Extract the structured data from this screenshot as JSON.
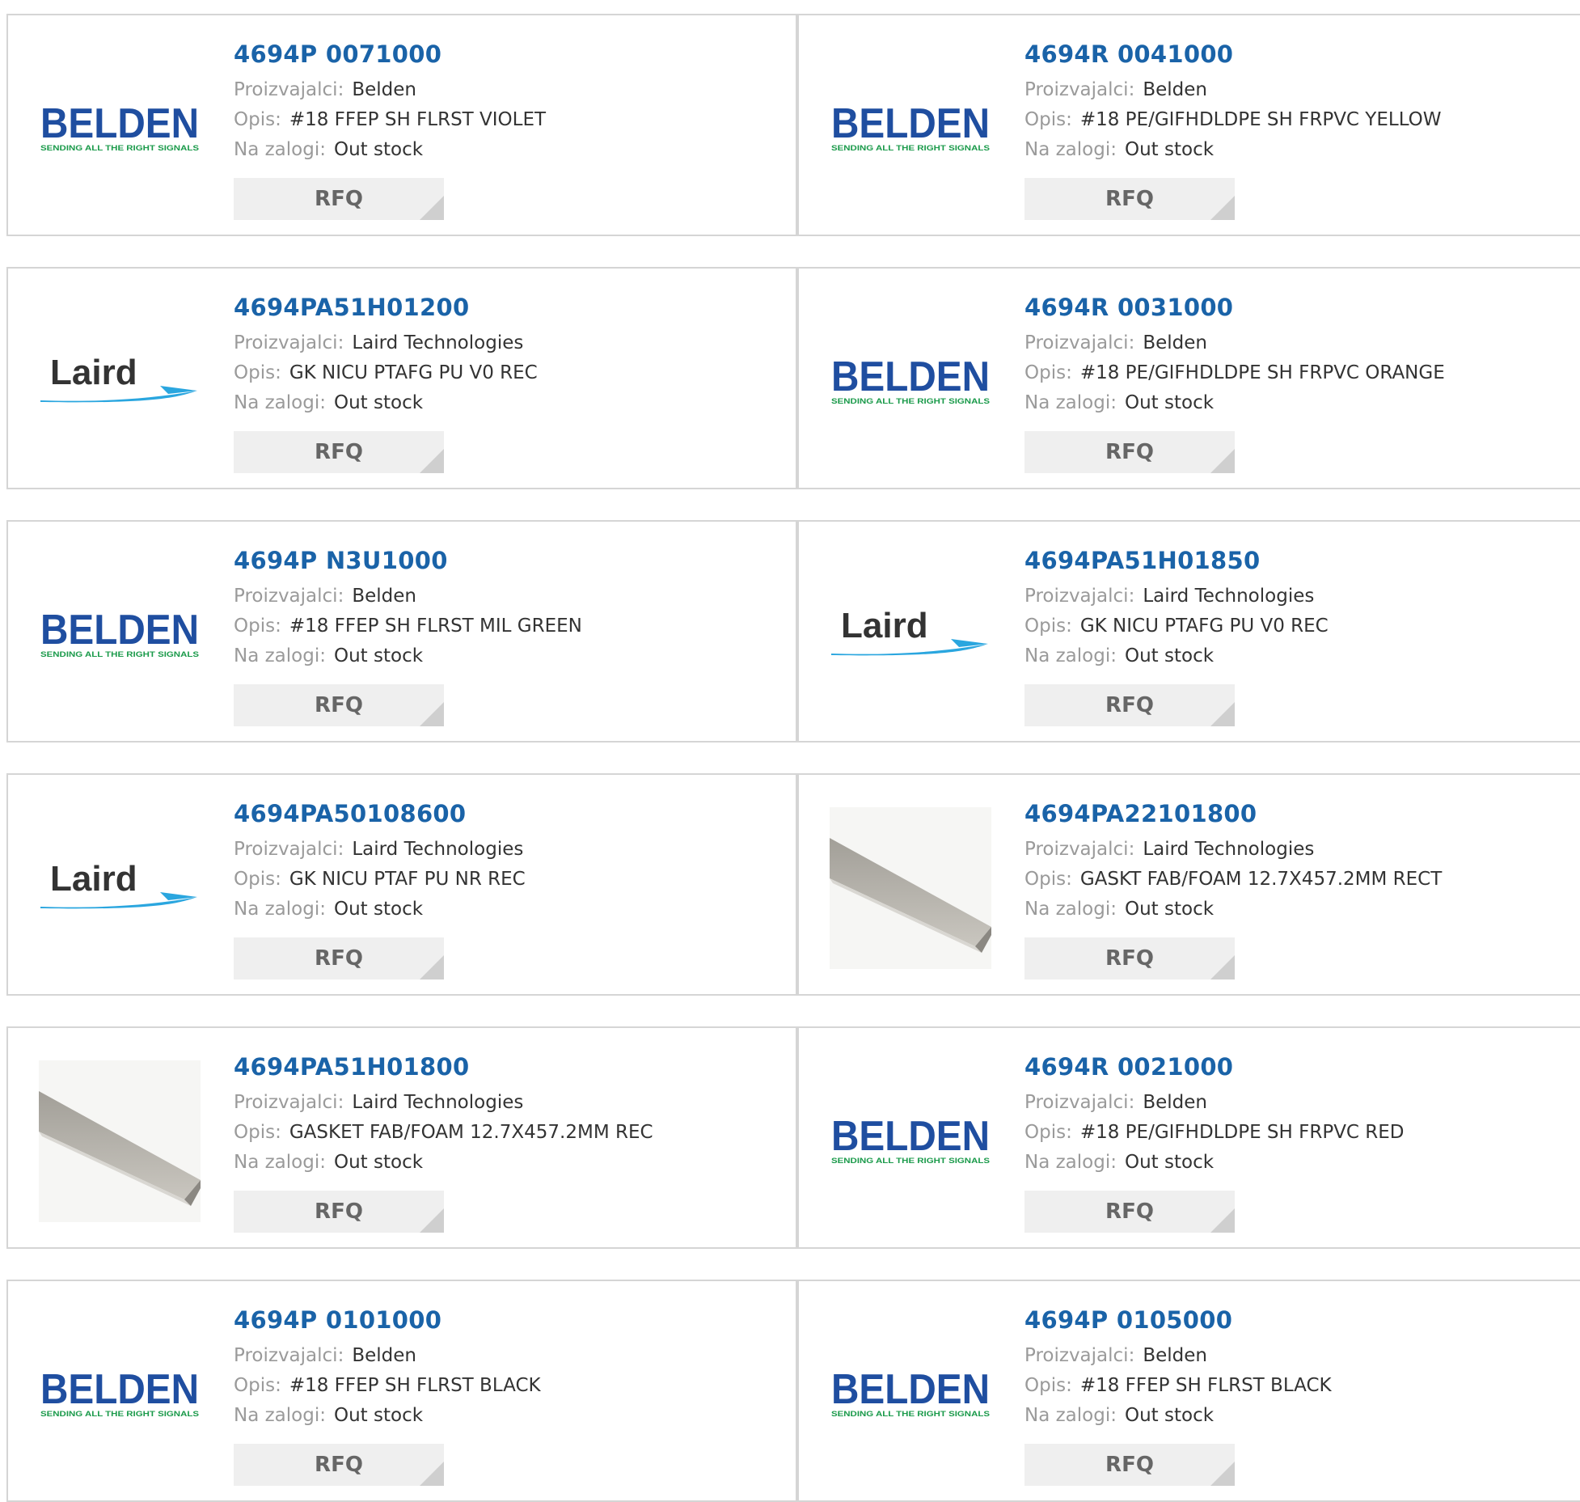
{
  "labels": {
    "manufacturer": "Proizvajalci:",
    "description": "Opis:",
    "stock": "Na zalogi:",
    "rfq": "RFQ"
  },
  "logos": {
    "belden_wordmark": "BELDEN",
    "belden_tagline": "SENDING ALL THE RIGHT SIGNALS",
    "laird_wordmark": "Laird"
  },
  "colors": {
    "part_number": "#1a63a8",
    "belden_blue": "#1f4ea0",
    "belden_green": "#1a9a4a",
    "laird_swoosh": "#2aa6df",
    "rfq_bg": "#efefef"
  },
  "products": [
    {
      "part": "4694P 0071000",
      "manufacturer": "Belden",
      "description": "#18 FFEP SH FLRST VIOLET",
      "stock": "Out stock",
      "image": "belden-logo"
    },
    {
      "part": "4694R 0041000",
      "manufacturer": "Belden",
      "description": "#18 PE/GIFHDLDPE SH FRPVC YELLOW",
      "stock": "Out stock",
      "image": "belden-logo"
    },
    {
      "part": "4694PA51H01200",
      "manufacturer": "Laird Technologies",
      "description": "GK NICU PTAFG PU V0 REC",
      "stock": "Out stock",
      "image": "laird-logo"
    },
    {
      "part": "4694R 0031000",
      "manufacturer": "Belden",
      "description": "#18 PE/GIFHDLDPE SH FRPVC ORANGE",
      "stock": "Out stock",
      "image": "belden-logo"
    },
    {
      "part": "4694P N3U1000",
      "manufacturer": "Belden",
      "description": "#18 FFEP SH FLRST MIL GREEN",
      "stock": "Out stock",
      "image": "belden-logo"
    },
    {
      "part": "4694PA51H01850",
      "manufacturer": "Laird Technologies",
      "description": "GK NICU PTAFG PU V0 REC",
      "stock": "Out stock",
      "image": "laird-logo"
    },
    {
      "part": "4694PA50108600",
      "manufacturer": "Laird Technologies",
      "description": "GK NICU PTAF PU NR REC",
      "stock": "Out stock",
      "image": "laird-logo"
    },
    {
      "part": "4694PA22101800",
      "manufacturer": "Laird Technologies",
      "description": "GASKT FAB/FOAM 12.7X457.2MM RECT",
      "stock": "Out stock",
      "image": "gasket-photo"
    },
    {
      "part": "4694PA51H01800",
      "manufacturer": "Laird Technologies",
      "description": "GASKET FAB/FOAM 12.7X457.2MM REC",
      "stock": "Out stock",
      "image": "gasket-photo"
    },
    {
      "part": "4694R 0021000",
      "manufacturer": "Belden",
      "description": "#18 PE/GIFHDLDPE SH FRPVC RED",
      "stock": "Out stock",
      "image": "belden-logo"
    },
    {
      "part": "4694P 0101000",
      "manufacturer": "Belden",
      "description": "#18 FFEP SH FLRST BLACK",
      "stock": "Out stock",
      "image": "belden-logo"
    },
    {
      "part": "4694P 0105000",
      "manufacturer": "Belden",
      "description": "#18 FFEP SH FLRST BLACK",
      "stock": "Out stock",
      "image": "belden-logo"
    }
  ]
}
